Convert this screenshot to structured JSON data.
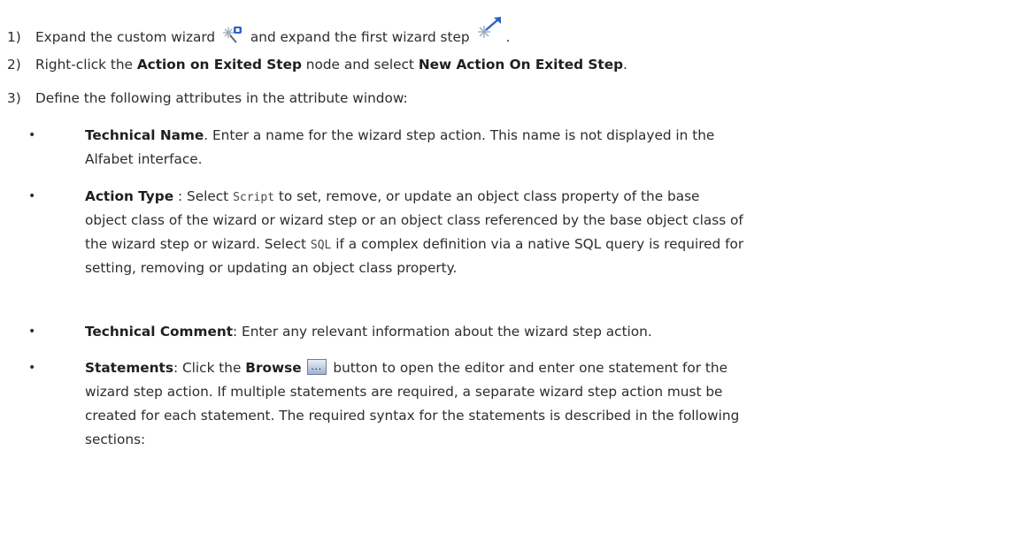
{
  "steps": [
    {
      "number": "1)",
      "part1": "Expand the custom wizard",
      "icon1": "custom-wizard-icon",
      "part2": "and expand the first wizard step",
      "icon2": "wizard-step-icon",
      "part3": "."
    },
    {
      "number": "2)",
      "part1": "Right-click the",
      "bold1": "Action on Exited Step",
      "part2": "node and select",
      "bold2": "New Action On Exited Step",
      "part3": "."
    },
    {
      "number": "3)",
      "text": "Define the following attributes in the attribute window:"
    }
  ],
  "bullets": [
    {
      "symbol": "•",
      "term": "Technical Name",
      "line1": ". Enter a name for the wizard step action. This name is not displayed in the",
      "line2": "Alfabet interface."
    },
    {
      "symbol": "•",
      "term": "Action Type",
      "line1_a": " : Select",
      "code1": "Script",
      "line1_b": "to set, remove, or update an object class property of the base",
      "line2": "object class of the wizard or wizard step or an object class referenced by the base object class of",
      "line3_a": "the wizard step or wizard. Select",
      "code2": "SQL",
      "line3_b": "if a complex definition via a native SQL query is required for",
      "line4": "setting, removing or updating an object class property."
    },
    {
      "symbol": "•",
      "term": "Technical Comment",
      "line1": ": Enter any relevant information about the wizard step action."
    },
    {
      "symbol": "•",
      "term": "Statements",
      "line1_a": ": Click the",
      "bold": "Browse",
      "button_glyph": "...",
      "button_icon": "browse-button-icon",
      "line1_b": "button to open the editor and enter one statement for the",
      "line2": "wizard step action. If multiple statements are required, a separate wizard step action must be",
      "line3": "created for each statement. The required syntax for the statements is described in the following",
      "line4": "sections:"
    }
  ]
}
